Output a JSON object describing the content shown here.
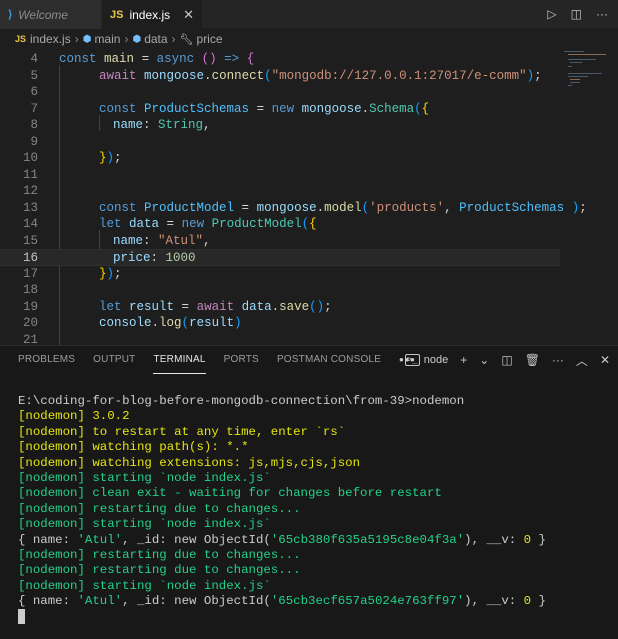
{
  "tabs": [
    {
      "label": "Welcome",
      "icon": "vscode-logo-icon",
      "active": false
    },
    {
      "label": "index.js",
      "icon": "js-file-icon",
      "active": true
    }
  ],
  "breadcrumb": [
    "index.js",
    "main",
    "data",
    "price"
  ],
  "editor": {
    "current_line": "16",
    "lines": [
      {
        "n": "4"
      },
      {
        "n": "5"
      },
      {
        "n": "6"
      },
      {
        "n": "7"
      },
      {
        "n": "8"
      },
      {
        "n": "9"
      },
      {
        "n": "10"
      },
      {
        "n": "11"
      },
      {
        "n": "12"
      },
      {
        "n": "13"
      },
      {
        "n": "14"
      },
      {
        "n": "15"
      },
      {
        "n": "16"
      },
      {
        "n": "17"
      },
      {
        "n": "18"
      },
      {
        "n": "19"
      },
      {
        "n": "20"
      },
      {
        "n": "21"
      }
    ],
    "code": {
      "l4": {
        "a": "const",
        "b": "main",
        "c": "=",
        "d": "async",
        "e": "()",
        "f": "=>",
        "g": "{"
      },
      "l5": {
        "a": "await",
        "b": "mongoose",
        "c": "connect",
        "d": "\"mongodb://127.0.0.1:27017/e-comm\""
      },
      "l7": {
        "a": "const",
        "b": "ProductSchemas",
        "c": "new",
        "d": "mongoose",
        "e": "Schema"
      },
      "l8": {
        "a": "name",
        "b": "String"
      },
      "l13": {
        "a": "const",
        "b": "ProductModel",
        "c": "mongoose",
        "d": "model",
        "e": "'products'",
        "f": "ProductSchemas"
      },
      "l14": {
        "a": "let",
        "b": "data",
        "c": "new",
        "d": "ProductModel"
      },
      "l15": {
        "a": "name",
        "b": "\"Atul\""
      },
      "l16": {
        "a": "price",
        "b": "1000"
      },
      "l19": {
        "a": "let",
        "b": "result",
        "c": "await",
        "d": "data",
        "e": "save"
      },
      "l20": {
        "a": "console",
        "b": "log",
        "c": "result"
      }
    }
  },
  "panel": {
    "tabs": [
      "PROBLEMS",
      "OUTPUT",
      "TERMINAL",
      "PORTS",
      "POSTMAN CONSOLE"
    ],
    "active_tab": "TERMINAL",
    "more": "•••",
    "terminal_name": "node"
  },
  "terminal": {
    "lines": [
      "E:\\coding-for-blog-before-mongodb-connection\\from-39>nodemon",
      "[nodemon] 3.0.2",
      "[nodemon] to restart at any time, enter `rs`",
      "[nodemon] watching path(s): *.*",
      "[nodemon] watching extensions: js,mjs,cjs,json",
      "[nodemon] starting `node index.js`",
      "[nodemon] clean exit - waiting for changes before restart",
      "[nodemon] restarting due to changes...",
      "[nodemon] starting `node index.js`",
      "",
      "[nodemon] restarting due to changes...",
      "[nodemon] restarting due to changes...",
      "[nodemon] starting `node index.js`",
      ""
    ],
    "result1": {
      "a": "{ name: ",
      "b": "'Atul'",
      "c": ", _id: new ObjectId(",
      "d": "'65cb380f635a5195c8e04f3a'",
      "e": "), __v: ",
      "f": "0",
      "g": " }"
    },
    "result2": {
      "a": "{ name: ",
      "b": "'Atul'",
      "c": ", _id: new ObjectId(",
      "d": "'65cb3ecf657a5024e763ff97'",
      "e": "), __v: ",
      "f": "0",
      "g": " }"
    }
  },
  "colors": {
    "editor_bg": "#1e1e1e",
    "panel_bg": "#181818",
    "nodemon_yellow": "#e5e510",
    "nodemon_green": "#23d18b"
  }
}
